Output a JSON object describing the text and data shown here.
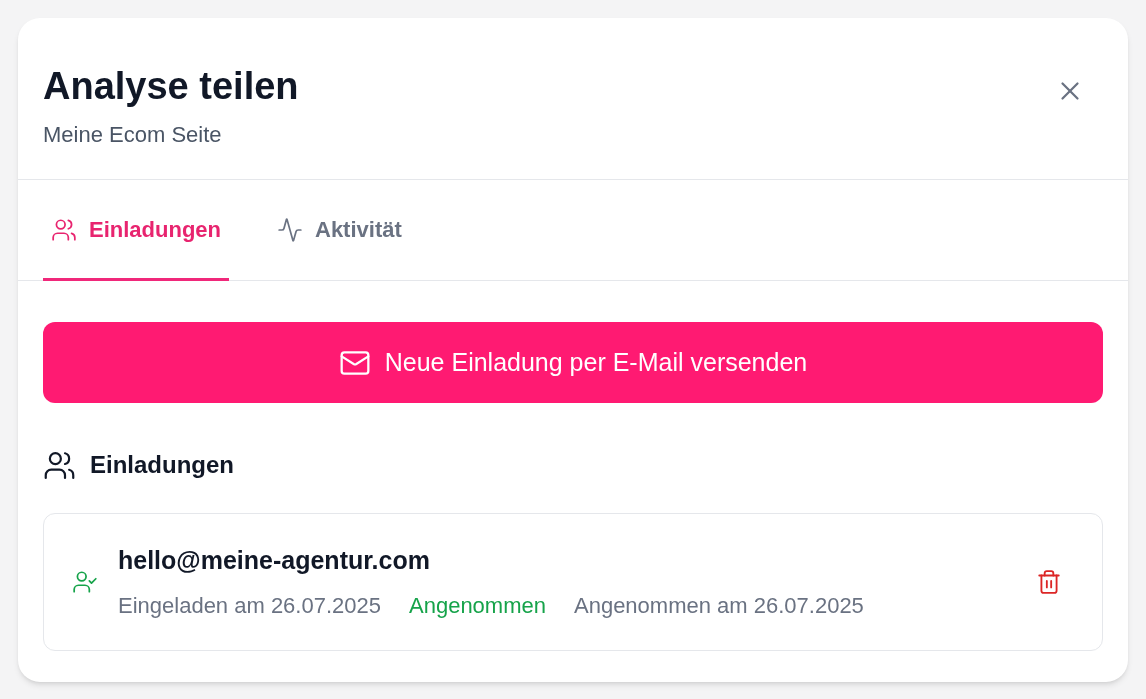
{
  "dialog": {
    "title": "Analyse teilen",
    "subtitle": "Meine Ecom Seite"
  },
  "tabs": [
    {
      "kind": "users",
      "label": "Einladungen",
      "selected": true
    },
    {
      "kind": "activity",
      "label": "Aktivität",
      "selected": false
    }
  ],
  "invite_button": {
    "label": "Neue Einladung per E-Mail versenden"
  },
  "section": {
    "title": "Einladungen"
  },
  "invitations": [
    {
      "email": "hello@meine-agentur.com",
      "invited": "Eingeladen am 26.07.2025",
      "status": "Angenommen",
      "accepted": true,
      "accepted_on": "Angenommen am 26.07.2025"
    }
  ]
}
